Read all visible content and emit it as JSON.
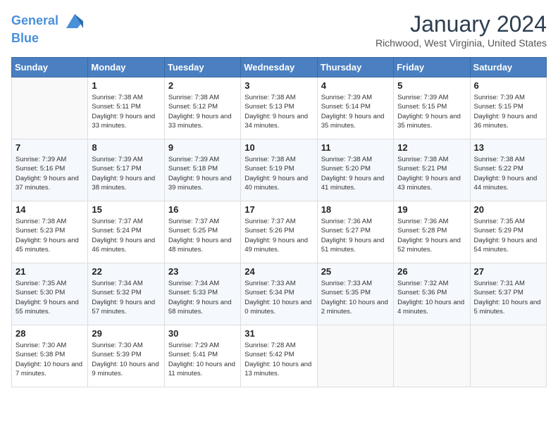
{
  "logo": {
    "line1": "General",
    "line2": "Blue"
  },
  "title": "January 2024",
  "location": "Richwood, West Virginia, United States",
  "weekdays": [
    "Sunday",
    "Monday",
    "Tuesday",
    "Wednesday",
    "Thursday",
    "Friday",
    "Saturday"
  ],
  "weeks": [
    [
      {
        "day": "",
        "sunrise": "",
        "sunset": "",
        "daylight": ""
      },
      {
        "day": "1",
        "sunrise": "Sunrise: 7:38 AM",
        "sunset": "Sunset: 5:11 PM",
        "daylight": "Daylight: 9 hours and 33 minutes."
      },
      {
        "day": "2",
        "sunrise": "Sunrise: 7:38 AM",
        "sunset": "Sunset: 5:12 PM",
        "daylight": "Daylight: 9 hours and 33 minutes."
      },
      {
        "day": "3",
        "sunrise": "Sunrise: 7:38 AM",
        "sunset": "Sunset: 5:13 PM",
        "daylight": "Daylight: 9 hours and 34 minutes."
      },
      {
        "day": "4",
        "sunrise": "Sunrise: 7:39 AM",
        "sunset": "Sunset: 5:14 PM",
        "daylight": "Daylight: 9 hours and 35 minutes."
      },
      {
        "day": "5",
        "sunrise": "Sunrise: 7:39 AM",
        "sunset": "Sunset: 5:15 PM",
        "daylight": "Daylight: 9 hours and 35 minutes."
      },
      {
        "day": "6",
        "sunrise": "Sunrise: 7:39 AM",
        "sunset": "Sunset: 5:15 PM",
        "daylight": "Daylight: 9 hours and 36 minutes."
      }
    ],
    [
      {
        "day": "7",
        "sunrise": "Sunrise: 7:39 AM",
        "sunset": "Sunset: 5:16 PM",
        "daylight": "Daylight: 9 hours and 37 minutes."
      },
      {
        "day": "8",
        "sunrise": "Sunrise: 7:39 AM",
        "sunset": "Sunset: 5:17 PM",
        "daylight": "Daylight: 9 hours and 38 minutes."
      },
      {
        "day": "9",
        "sunrise": "Sunrise: 7:39 AM",
        "sunset": "Sunset: 5:18 PM",
        "daylight": "Daylight: 9 hours and 39 minutes."
      },
      {
        "day": "10",
        "sunrise": "Sunrise: 7:38 AM",
        "sunset": "Sunset: 5:19 PM",
        "daylight": "Daylight: 9 hours and 40 minutes."
      },
      {
        "day": "11",
        "sunrise": "Sunrise: 7:38 AM",
        "sunset": "Sunset: 5:20 PM",
        "daylight": "Daylight: 9 hours and 41 minutes."
      },
      {
        "day": "12",
        "sunrise": "Sunrise: 7:38 AM",
        "sunset": "Sunset: 5:21 PM",
        "daylight": "Daylight: 9 hours and 43 minutes."
      },
      {
        "day": "13",
        "sunrise": "Sunrise: 7:38 AM",
        "sunset": "Sunset: 5:22 PM",
        "daylight": "Daylight: 9 hours and 44 minutes."
      }
    ],
    [
      {
        "day": "14",
        "sunrise": "Sunrise: 7:38 AM",
        "sunset": "Sunset: 5:23 PM",
        "daylight": "Daylight: 9 hours and 45 minutes."
      },
      {
        "day": "15",
        "sunrise": "Sunrise: 7:37 AM",
        "sunset": "Sunset: 5:24 PM",
        "daylight": "Daylight: 9 hours and 46 minutes."
      },
      {
        "day": "16",
        "sunrise": "Sunrise: 7:37 AM",
        "sunset": "Sunset: 5:25 PM",
        "daylight": "Daylight: 9 hours and 48 minutes."
      },
      {
        "day": "17",
        "sunrise": "Sunrise: 7:37 AM",
        "sunset": "Sunset: 5:26 PM",
        "daylight": "Daylight: 9 hours and 49 minutes."
      },
      {
        "day": "18",
        "sunrise": "Sunrise: 7:36 AM",
        "sunset": "Sunset: 5:27 PM",
        "daylight": "Daylight: 9 hours and 51 minutes."
      },
      {
        "day": "19",
        "sunrise": "Sunrise: 7:36 AM",
        "sunset": "Sunset: 5:28 PM",
        "daylight": "Daylight: 9 hours and 52 minutes."
      },
      {
        "day": "20",
        "sunrise": "Sunrise: 7:35 AM",
        "sunset": "Sunset: 5:29 PM",
        "daylight": "Daylight: 9 hours and 54 minutes."
      }
    ],
    [
      {
        "day": "21",
        "sunrise": "Sunrise: 7:35 AM",
        "sunset": "Sunset: 5:30 PM",
        "daylight": "Daylight: 9 hours and 55 minutes."
      },
      {
        "day": "22",
        "sunrise": "Sunrise: 7:34 AM",
        "sunset": "Sunset: 5:32 PM",
        "daylight": "Daylight: 9 hours and 57 minutes."
      },
      {
        "day": "23",
        "sunrise": "Sunrise: 7:34 AM",
        "sunset": "Sunset: 5:33 PM",
        "daylight": "Daylight: 9 hours and 58 minutes."
      },
      {
        "day": "24",
        "sunrise": "Sunrise: 7:33 AM",
        "sunset": "Sunset: 5:34 PM",
        "daylight": "Daylight: 10 hours and 0 minutes."
      },
      {
        "day": "25",
        "sunrise": "Sunrise: 7:33 AM",
        "sunset": "Sunset: 5:35 PM",
        "daylight": "Daylight: 10 hours and 2 minutes."
      },
      {
        "day": "26",
        "sunrise": "Sunrise: 7:32 AM",
        "sunset": "Sunset: 5:36 PM",
        "daylight": "Daylight: 10 hours and 4 minutes."
      },
      {
        "day": "27",
        "sunrise": "Sunrise: 7:31 AM",
        "sunset": "Sunset: 5:37 PM",
        "daylight": "Daylight: 10 hours and 5 minutes."
      }
    ],
    [
      {
        "day": "28",
        "sunrise": "Sunrise: 7:30 AM",
        "sunset": "Sunset: 5:38 PM",
        "daylight": "Daylight: 10 hours and 7 minutes."
      },
      {
        "day": "29",
        "sunrise": "Sunrise: 7:30 AM",
        "sunset": "Sunset: 5:39 PM",
        "daylight": "Daylight: 10 hours and 9 minutes."
      },
      {
        "day": "30",
        "sunrise": "Sunrise: 7:29 AM",
        "sunset": "Sunset: 5:41 PM",
        "daylight": "Daylight: 10 hours and 11 minutes."
      },
      {
        "day": "31",
        "sunrise": "Sunrise: 7:28 AM",
        "sunset": "Sunset: 5:42 PM",
        "daylight": "Daylight: 10 hours and 13 minutes."
      },
      {
        "day": "",
        "sunrise": "",
        "sunset": "",
        "daylight": ""
      },
      {
        "day": "",
        "sunrise": "",
        "sunset": "",
        "daylight": ""
      },
      {
        "day": "",
        "sunrise": "",
        "sunset": "",
        "daylight": ""
      }
    ]
  ]
}
